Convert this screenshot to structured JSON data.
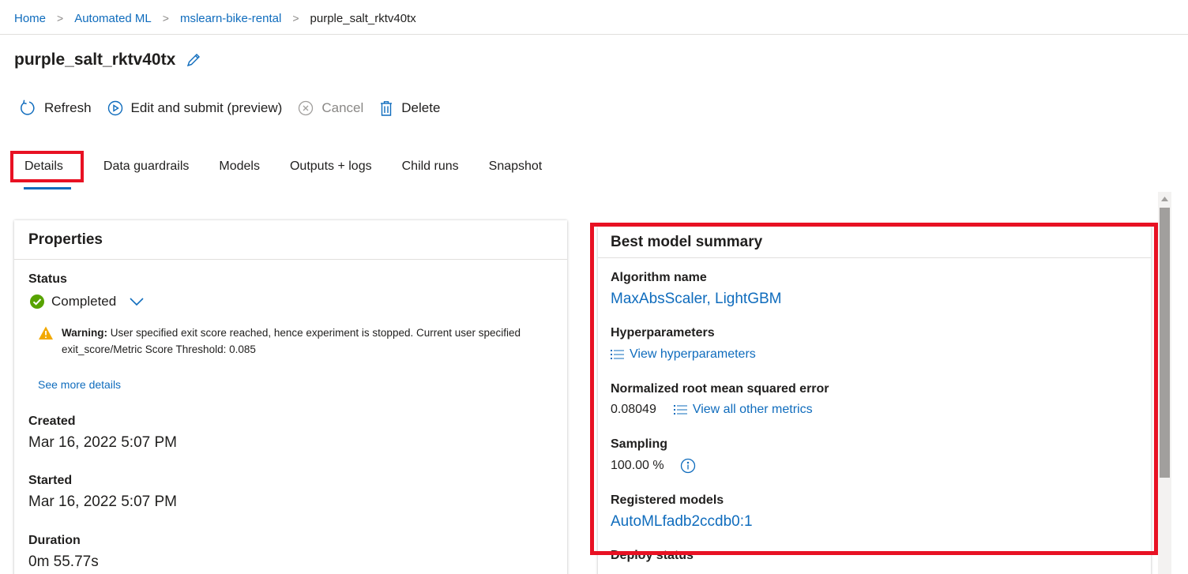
{
  "breadcrumb": {
    "items": [
      "Home",
      "Automated ML",
      "mslearn-bike-rental"
    ],
    "current": "purple_salt_rktv40tx",
    "separator": ">"
  },
  "title": "purple_salt_rktv40tx",
  "toolbar": {
    "refresh": "Refresh",
    "edit_submit": "Edit and submit (preview)",
    "cancel": "Cancel",
    "delete": "Delete"
  },
  "tabs": [
    "Details",
    "Data guardrails",
    "Models",
    "Outputs + logs",
    "Child runs",
    "Snapshot"
  ],
  "active_tab": "Details",
  "properties": {
    "header": "Properties",
    "status_label": "Status",
    "status_value": "Completed",
    "warning_bold": "Warning:",
    "warning_text": "User specified exit score reached, hence experiment is stopped. Current user specified exit_score/Metric Score Threshold: 0.085",
    "see_more": "See more details",
    "created_label": "Created",
    "created_value": "Mar 16, 2022 5:07 PM",
    "started_label": "Started",
    "started_value": "Mar 16, 2022 5:07 PM",
    "duration_label": "Duration",
    "duration_value": "0m 55.77s"
  },
  "best_model": {
    "header": "Best model summary",
    "algorithm_label": "Algorithm name",
    "algorithm_value": "MaxAbsScaler, LightGBM",
    "hyper_label": "Hyperparameters",
    "hyper_link": "View hyperparameters",
    "nrmse_label": "Normalized root mean squared error",
    "nrmse_value": "0.08049",
    "other_metrics_link": "View all other metrics",
    "sampling_label": "Sampling",
    "sampling_value": "100.00 %",
    "registered_label": "Registered models",
    "registered_value": "AutoMLfadb2ccdb0:1",
    "deploy_label": "Deploy status"
  },
  "colors": {
    "accent": "#0f6cbd",
    "highlight": "#e81123",
    "success": "#57a300",
    "warning": "#f2a900"
  },
  "icons": [
    "refresh-icon",
    "play-circle-icon",
    "cancel-circle-icon",
    "trash-icon",
    "pencil-icon",
    "check-circle-icon",
    "chevron-down-icon",
    "warning-icon",
    "list-icon",
    "info-icon"
  ]
}
